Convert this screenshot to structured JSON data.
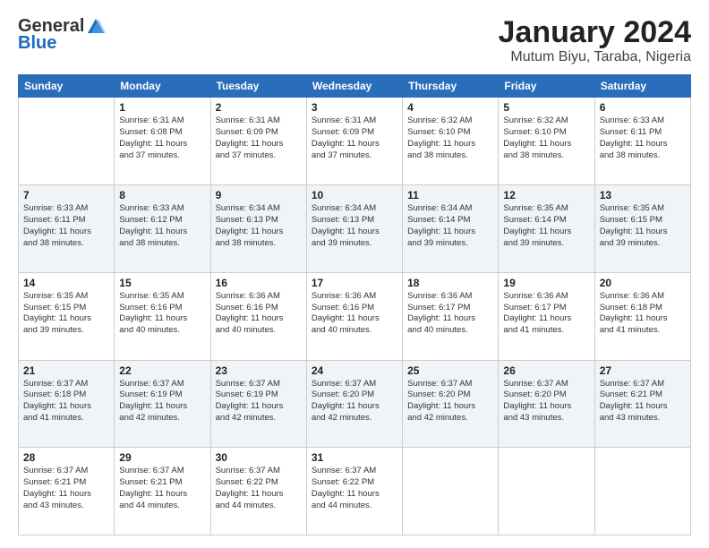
{
  "header": {
    "logo_general": "General",
    "logo_blue": "Blue",
    "title": "January 2024",
    "subtitle": "Mutum Biyu, Taraba, Nigeria"
  },
  "days_of_week": [
    "Sunday",
    "Monday",
    "Tuesday",
    "Wednesday",
    "Thursday",
    "Friday",
    "Saturday"
  ],
  "weeks": [
    [
      {
        "day": "",
        "info": ""
      },
      {
        "day": "1",
        "info": "Sunrise: 6:31 AM\nSunset: 6:08 PM\nDaylight: 11 hours\nand 37 minutes."
      },
      {
        "day": "2",
        "info": "Sunrise: 6:31 AM\nSunset: 6:09 PM\nDaylight: 11 hours\nand 37 minutes."
      },
      {
        "day": "3",
        "info": "Sunrise: 6:31 AM\nSunset: 6:09 PM\nDaylight: 11 hours\nand 37 minutes."
      },
      {
        "day": "4",
        "info": "Sunrise: 6:32 AM\nSunset: 6:10 PM\nDaylight: 11 hours\nand 38 minutes."
      },
      {
        "day": "5",
        "info": "Sunrise: 6:32 AM\nSunset: 6:10 PM\nDaylight: 11 hours\nand 38 minutes."
      },
      {
        "day": "6",
        "info": "Sunrise: 6:33 AM\nSunset: 6:11 PM\nDaylight: 11 hours\nand 38 minutes."
      }
    ],
    [
      {
        "day": "7",
        "info": "Sunrise: 6:33 AM\nSunset: 6:11 PM\nDaylight: 11 hours\nand 38 minutes."
      },
      {
        "day": "8",
        "info": "Sunrise: 6:33 AM\nSunset: 6:12 PM\nDaylight: 11 hours\nand 38 minutes."
      },
      {
        "day": "9",
        "info": "Sunrise: 6:34 AM\nSunset: 6:13 PM\nDaylight: 11 hours\nand 38 minutes."
      },
      {
        "day": "10",
        "info": "Sunrise: 6:34 AM\nSunset: 6:13 PM\nDaylight: 11 hours\nand 39 minutes."
      },
      {
        "day": "11",
        "info": "Sunrise: 6:34 AM\nSunset: 6:14 PM\nDaylight: 11 hours\nand 39 minutes."
      },
      {
        "day": "12",
        "info": "Sunrise: 6:35 AM\nSunset: 6:14 PM\nDaylight: 11 hours\nand 39 minutes."
      },
      {
        "day": "13",
        "info": "Sunrise: 6:35 AM\nSunset: 6:15 PM\nDaylight: 11 hours\nand 39 minutes."
      }
    ],
    [
      {
        "day": "14",
        "info": "Sunrise: 6:35 AM\nSunset: 6:15 PM\nDaylight: 11 hours\nand 39 minutes."
      },
      {
        "day": "15",
        "info": "Sunrise: 6:35 AM\nSunset: 6:16 PM\nDaylight: 11 hours\nand 40 minutes."
      },
      {
        "day": "16",
        "info": "Sunrise: 6:36 AM\nSunset: 6:16 PM\nDaylight: 11 hours\nand 40 minutes."
      },
      {
        "day": "17",
        "info": "Sunrise: 6:36 AM\nSunset: 6:16 PM\nDaylight: 11 hours\nand 40 minutes."
      },
      {
        "day": "18",
        "info": "Sunrise: 6:36 AM\nSunset: 6:17 PM\nDaylight: 11 hours\nand 40 minutes."
      },
      {
        "day": "19",
        "info": "Sunrise: 6:36 AM\nSunset: 6:17 PM\nDaylight: 11 hours\nand 41 minutes."
      },
      {
        "day": "20",
        "info": "Sunrise: 6:36 AM\nSunset: 6:18 PM\nDaylight: 11 hours\nand 41 minutes."
      }
    ],
    [
      {
        "day": "21",
        "info": "Sunrise: 6:37 AM\nSunset: 6:18 PM\nDaylight: 11 hours\nand 41 minutes."
      },
      {
        "day": "22",
        "info": "Sunrise: 6:37 AM\nSunset: 6:19 PM\nDaylight: 11 hours\nand 42 minutes."
      },
      {
        "day": "23",
        "info": "Sunrise: 6:37 AM\nSunset: 6:19 PM\nDaylight: 11 hours\nand 42 minutes."
      },
      {
        "day": "24",
        "info": "Sunrise: 6:37 AM\nSunset: 6:20 PM\nDaylight: 11 hours\nand 42 minutes."
      },
      {
        "day": "25",
        "info": "Sunrise: 6:37 AM\nSunset: 6:20 PM\nDaylight: 11 hours\nand 42 minutes."
      },
      {
        "day": "26",
        "info": "Sunrise: 6:37 AM\nSunset: 6:20 PM\nDaylight: 11 hours\nand 43 minutes."
      },
      {
        "day": "27",
        "info": "Sunrise: 6:37 AM\nSunset: 6:21 PM\nDaylight: 11 hours\nand 43 minutes."
      }
    ],
    [
      {
        "day": "28",
        "info": "Sunrise: 6:37 AM\nSunset: 6:21 PM\nDaylight: 11 hours\nand 43 minutes."
      },
      {
        "day": "29",
        "info": "Sunrise: 6:37 AM\nSunset: 6:21 PM\nDaylight: 11 hours\nand 44 minutes."
      },
      {
        "day": "30",
        "info": "Sunrise: 6:37 AM\nSunset: 6:22 PM\nDaylight: 11 hours\nand 44 minutes."
      },
      {
        "day": "31",
        "info": "Sunrise: 6:37 AM\nSunset: 6:22 PM\nDaylight: 11 hours\nand 44 minutes."
      },
      {
        "day": "",
        "info": ""
      },
      {
        "day": "",
        "info": ""
      },
      {
        "day": "",
        "info": ""
      }
    ]
  ]
}
